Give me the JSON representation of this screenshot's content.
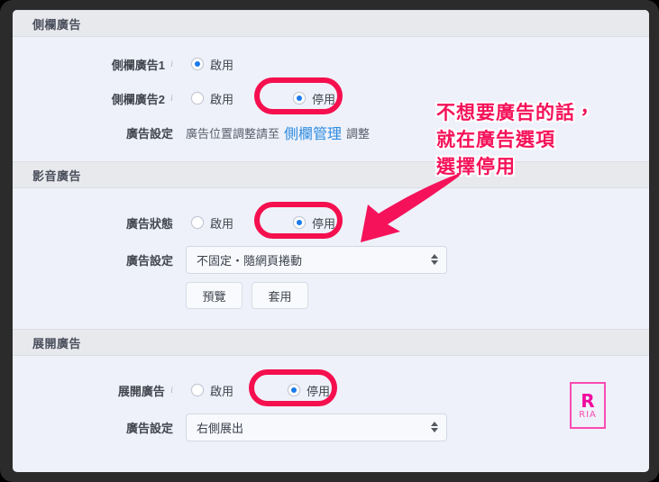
{
  "sections": [
    {
      "title": "側欄廣告",
      "rows": [
        {
          "label": "側欄廣告1",
          "info_icon": "i",
          "type": "radio",
          "options": [
            {
              "text": "啟用",
              "checked": true
            }
          ],
          "highlight": false
        },
        {
          "label": "側欄廣告2",
          "info_icon": "i",
          "type": "radio",
          "options": [
            {
              "text": "啟用",
              "checked": false
            },
            {
              "text": "停用",
              "checked": true
            }
          ],
          "highlight": true
        },
        {
          "label": "廣告設定",
          "type": "note",
          "note_before": "廣告位置調整請至",
          "note_link": "側欄管理",
          "note_after": "調整"
        }
      ]
    },
    {
      "title": "影音廣告",
      "rows": [
        {
          "label": "廣告狀態",
          "type": "radio",
          "options": [
            {
              "text": "啟用",
              "checked": false
            },
            {
              "text": "停用",
              "checked": true
            }
          ],
          "highlight": true
        },
        {
          "label": "廣告設定",
          "type": "select",
          "value": "不固定・隨網頁捲動"
        },
        {
          "label": "",
          "type": "buttons",
          "buttons": [
            "預覽",
            "套用"
          ]
        }
      ]
    },
    {
      "title": "展開廣告",
      "rows": [
        {
          "label": "展開廣告",
          "info_icon": "i",
          "type": "radio",
          "options": [
            {
              "text": "啟用",
              "checked": false
            },
            {
              "text": "停用",
              "checked": true
            }
          ],
          "highlight": true
        },
        {
          "label": "廣告設定",
          "type": "select",
          "value": "右側展出"
        }
      ]
    }
  ],
  "annotation": {
    "line1": "不想要廣告的話，",
    "line2": "就在廣告選項",
    "line3": "選擇停用"
  },
  "logo": {
    "mark": "R",
    "sub": "RIA"
  },
  "colors": {
    "highlight_pink": "#f50f4e",
    "annotation_pink": "#f5125a",
    "link_blue": "#2d8be0",
    "radio_blue": "#1a7aee",
    "page_bg": "#eef1fa",
    "section_head_bg": "#e8e9ed",
    "logo_pink": "#f209a0"
  }
}
